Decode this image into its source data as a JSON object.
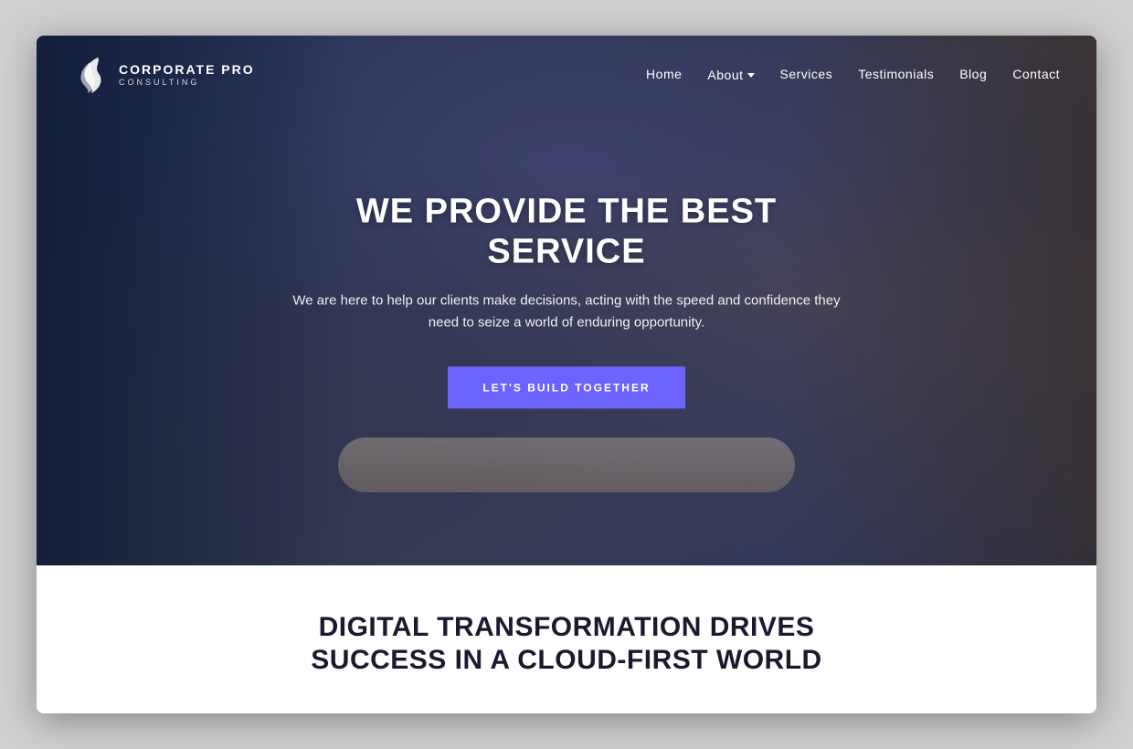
{
  "browser": {
    "shadow": true
  },
  "logo": {
    "company_name": "CORPORATE PRO",
    "tagline": "CONSULTING"
  },
  "nav": {
    "items": [
      {
        "label": "Home",
        "active": true,
        "has_dropdown": false
      },
      {
        "label": "About",
        "active": false,
        "has_dropdown": true
      },
      {
        "label": "Services",
        "active": false,
        "has_dropdown": false
      },
      {
        "label": "Testimonials",
        "active": false,
        "has_dropdown": false
      },
      {
        "label": "Blog",
        "active": false,
        "has_dropdown": false
      },
      {
        "label": "Contact",
        "active": false,
        "has_dropdown": false
      }
    ]
  },
  "hero": {
    "title": "WE PROVIDE THE BEST SERVICE",
    "subtitle": "We are here to help our clients make decisions, acting with the speed and confidence they need to seize a world of enduring opportunity.",
    "cta_button": "LET'S BUILD TOGETHER"
  },
  "below_hero": {
    "title_line1": "DIGITAL TRANSFORMATION DRIVES",
    "title_line2": "SUCCESS IN A CLOUD-FIRST WORLD"
  },
  "colors": {
    "accent": "#6c63ff",
    "hero_overlay": "rgba(30,50,100,0.65)",
    "nav_bg": "transparent",
    "text_dark": "#1a1a2e"
  }
}
